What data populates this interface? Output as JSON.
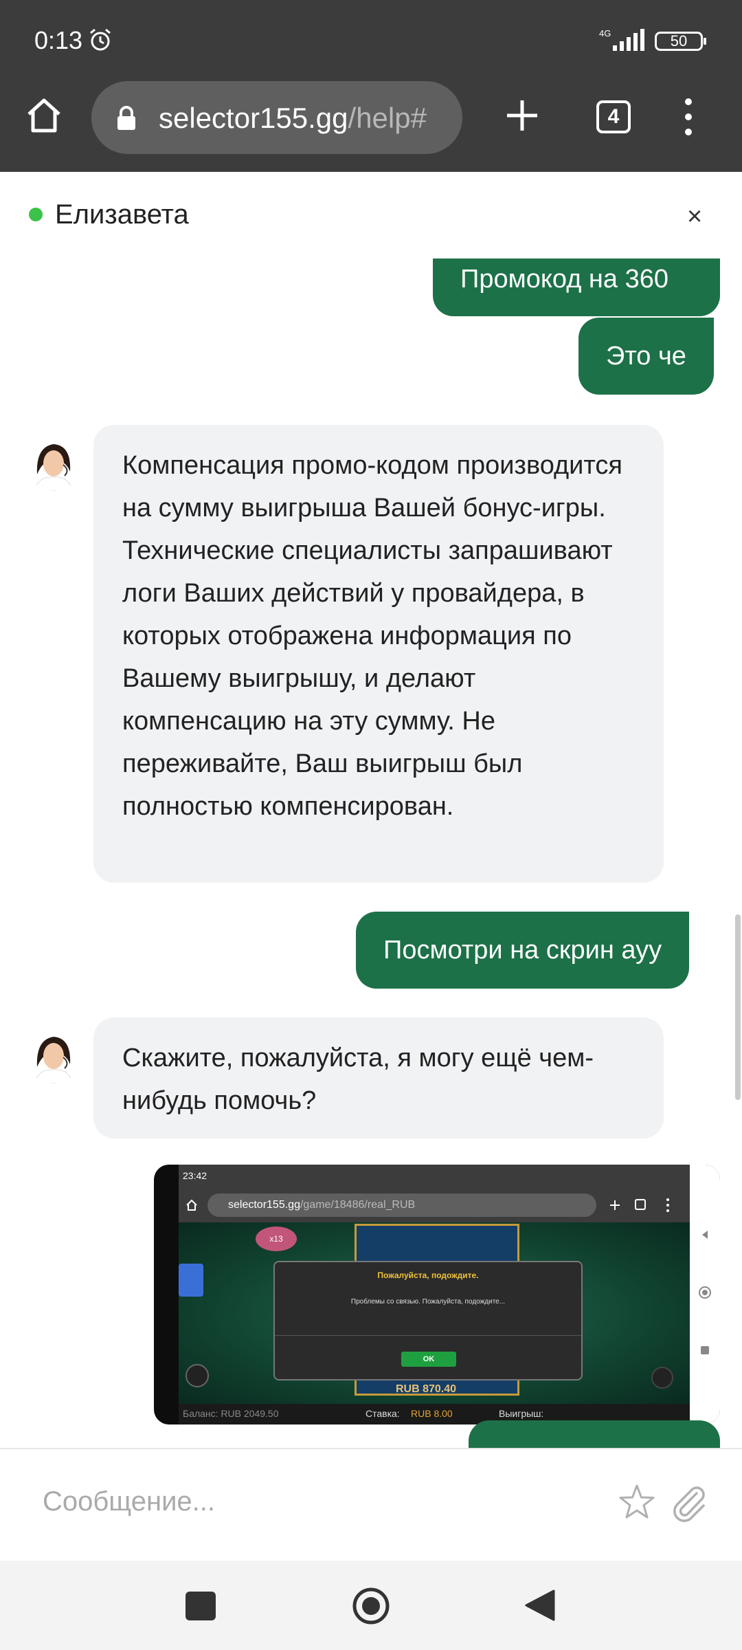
{
  "status": {
    "time": "0:13",
    "network": "4G",
    "battery": "50"
  },
  "browser": {
    "domain": "selector155.gg",
    "path": "/help#",
    "tab_count": "4"
  },
  "chat": {
    "agent_name": "Елизавета",
    "close_label": "×",
    "messages": [
      {
        "from": "user",
        "text": "Промокод на 360"
      },
      {
        "from": "user",
        "text": "Это че"
      },
      {
        "from": "agent",
        "text": "Компенсация промо-кодом производится на сумму выигрыша Вашей бонус-игры. Технические специалисты запрашивают логи Ваших действий у провайдера, в которых отображена информация по Вашему выигрышу, и делают компенсацию на эту сумму. Не переживайте, Ваш выигрыш был полностью компенсирован."
      },
      {
        "from": "user",
        "text": "Посмотри на скрин ауу"
      },
      {
        "from": "agent",
        "text": "Скажите, пожалуйста, я могу ещё чем-нибудь помочь?"
      }
    ],
    "attachment": {
      "time": "23:42",
      "url_domain": "selector155.gg",
      "url_path": "/game/18486/real_RUB",
      "dialog_title": "Пожалуйста, подождите.",
      "dialog_message": "Проблемы со связью. Пожалуйста, подождите...",
      "dialog_button": "OK",
      "win_amount": "RUB 870.40",
      "balance": "Баланс: RUB 2049.50",
      "bet_label": "Ставка:",
      "bet_value": "RUB 8.00",
      "win_label": "Выигрыш:",
      "badge": "x13"
    },
    "input_placeholder": "Сообщение..."
  },
  "colors": {
    "user_bubble": "#1d7148",
    "agent_bubble": "#f1f2f4",
    "online": "#3cc24a",
    "chrome": "#3c3c3c"
  }
}
